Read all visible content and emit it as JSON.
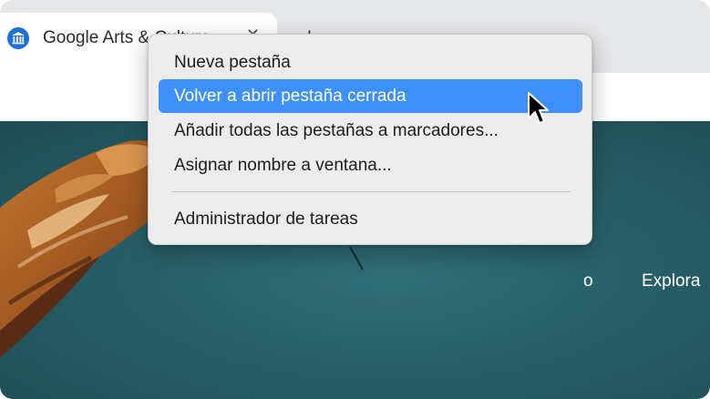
{
  "tab": {
    "title": "Google Arts & Culture",
    "favicon": "museum-icon",
    "close_icon": "close-icon"
  },
  "new_tab_button": {
    "glyph": "+"
  },
  "page": {
    "nav_item_partial": "o",
    "nav_explore": "Explora"
  },
  "context_menu": {
    "items": [
      {
        "label": "Nueva pestaña",
        "highlighted": false
      },
      {
        "label": "Volver a abrir pestaña cerrada",
        "highlighted": true
      },
      {
        "label": "Añadir todas las pestañas a marcadores...",
        "highlighted": false
      },
      {
        "label": "Asignar nombre a ventana...",
        "highlighted": false
      },
      {
        "label": "Administrador de tareas",
        "highlighted": false
      }
    ]
  },
  "colors": {
    "highlight": "#3f8ff8",
    "menu_background": "#ececec",
    "page_background": "#2a6670",
    "chrome_background": "#e6e7e9"
  }
}
